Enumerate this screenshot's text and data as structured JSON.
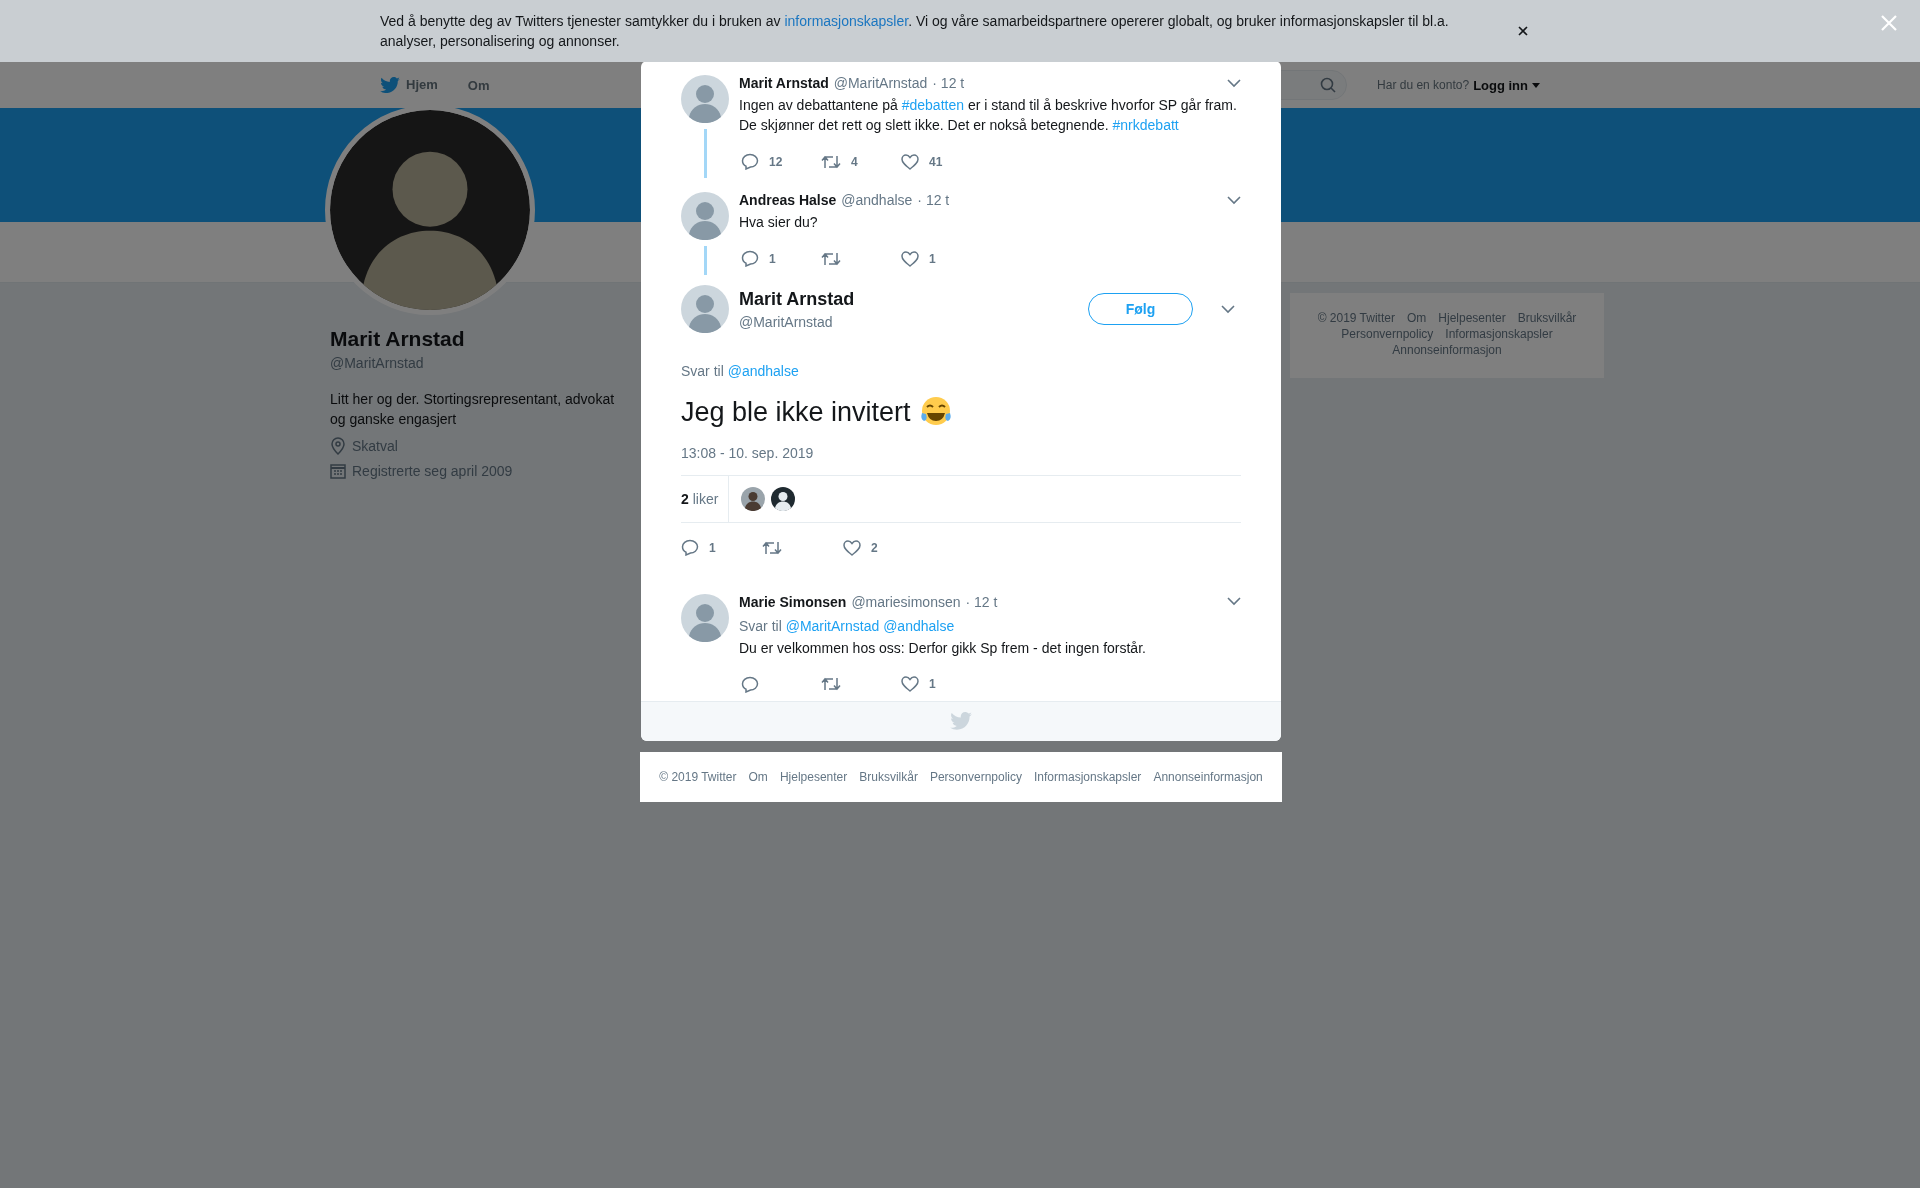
{
  "cookie_banner": {
    "text_before": "Ved å benytte deg av Twitters tjenester samtykker du i bruken av ",
    "link": "informasjonskapsler",
    "text_after": ". Vi og våre samarbeidspartnere opererer globalt, og bruker informasjonskapsler til bl.a. analyser, personalisering og annonser."
  },
  "nav": {
    "items": [
      {
        "label": "Hjem",
        "kind": "home"
      },
      {
        "label": "Om",
        "kind": "link"
      }
    ],
    "login_prompt": "Har du en konto?",
    "login": "Logg inn"
  },
  "profile": {
    "name": "Marit Arnstad",
    "handle": "@MaritArnstad",
    "bio": "Litt her og der. Stortingsrepresentant, advokat og ganske engasjert",
    "location": "Skatval",
    "joined": "Registrerte seg april 2009"
  },
  "sidebar_footer": [
    "© 2019 Twitter",
    "Om",
    "Hjelpesenter",
    "Bruksvilkår",
    "Personvernpolicy",
    "Informasjonskapsler",
    "Annonseinformasjon"
  ],
  "modal": {
    "thread": [
      {
        "name": "Marit Arnstad",
        "handle": "@MaritArnstad",
        "time": "· 12 t",
        "connected": true,
        "parts": [
          {
            "kind": "text",
            "text": "Ingen av debattantene på "
          },
          {
            "kind": "hashtag",
            "text": "#debatten"
          },
          {
            "kind": "text",
            "text": " er i stand til å beskrive hvorfor SP går fram. De skjønner det rett og slett ikke. Det er nokså betegnende. "
          },
          {
            "kind": "hashtag",
            "text": "#nrkdebatt"
          }
        ],
        "replies": "12",
        "retweets": "4",
        "likes": "41"
      },
      {
        "name": "Andreas Halse",
        "handle": "@andhalse",
        "time": "· 12 t",
        "connected": true,
        "parts": [
          {
            "kind": "text",
            "text": "Hva sier du?"
          }
        ],
        "replies": "1",
        "likes": "1"
      }
    ],
    "focus": {
      "name": "Marit Arnstad",
      "handle": "@MaritArnstad",
      "follow": "Følg",
      "reply_prefix": "Svar til",
      "mentions": [
        "@andhalse"
      ],
      "text": "Jeg ble ikke invitert",
      "timestamp": "13:08 - 10. sep. 2019",
      "likes_summary": "**2** liker",
      "replies": "1",
      "likes": "2"
    },
    "replies": [
      {
        "name": "Marie Simonsen",
        "handle": "@mariesimonsen",
        "time": "· 12 t",
        "reply_prefix": "Svar til",
        "mentions": [
          "@MaritArnstad",
          "@andhalse"
        ],
        "parts": [
          {
            "kind": "text",
            "text": "Du er velkommen hos oss: Derfor gikk Sp frem - det ingen forstår."
          }
        ],
        "likes": "1"
      }
    ]
  },
  "footer": [
    "© 2019 Twitter",
    "Om",
    "Hjelpesenter",
    "Bruksvilkår",
    "Personvernpolicy",
    "Informasjonskapsler",
    "Annonseinformasjon"
  ]
}
